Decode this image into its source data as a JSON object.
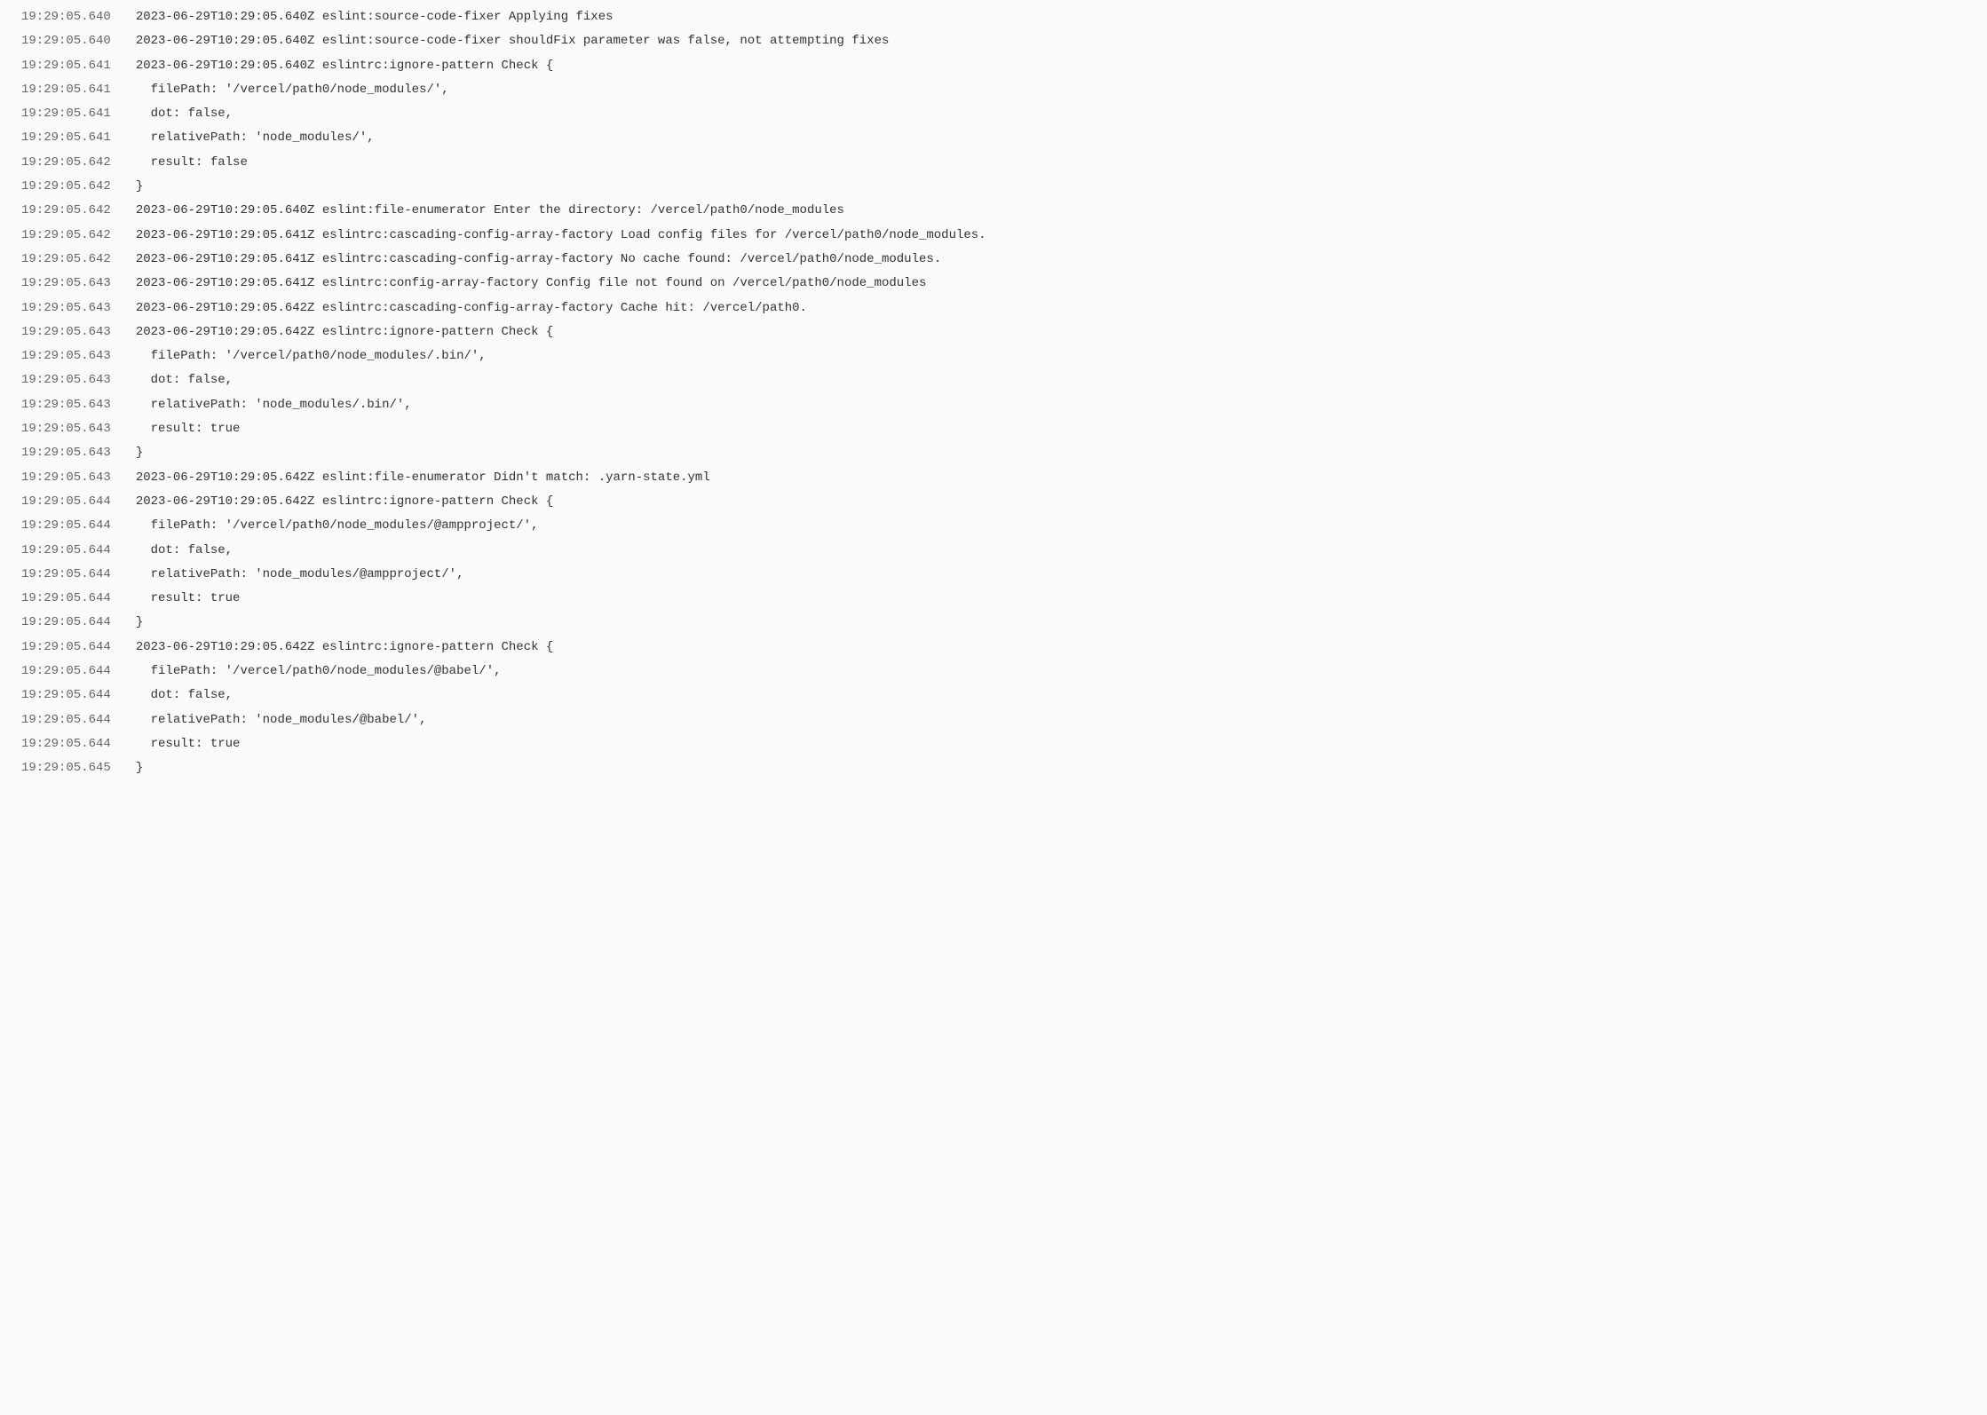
{
  "logs": [
    {
      "ts": "19:29:05.640",
      "msg": "2023-06-29T10:29:05.640Z eslint:source-code-fixer Applying fixes"
    },
    {
      "ts": "19:29:05.640",
      "msg": "2023-06-29T10:29:05.640Z eslint:source-code-fixer shouldFix parameter was false, not attempting fixes"
    },
    {
      "ts": "19:29:05.641",
      "msg": "2023-06-29T10:29:05.640Z eslintrc:ignore-pattern Check {"
    },
    {
      "ts": "19:29:05.641",
      "msg": "  filePath: '/vercel/path0/node_modules/',"
    },
    {
      "ts": "19:29:05.641",
      "msg": "  dot: false,"
    },
    {
      "ts": "19:29:05.641",
      "msg": "  relativePath: 'node_modules/',"
    },
    {
      "ts": "19:29:05.642",
      "msg": "  result: false"
    },
    {
      "ts": "19:29:05.642",
      "msg": "}"
    },
    {
      "ts": "19:29:05.642",
      "msg": "2023-06-29T10:29:05.640Z eslint:file-enumerator Enter the directory: /vercel/path0/node_modules"
    },
    {
      "ts": "19:29:05.642",
      "msg": "2023-06-29T10:29:05.641Z eslintrc:cascading-config-array-factory Load config files for /vercel/path0/node_modules."
    },
    {
      "ts": "19:29:05.642",
      "msg": "2023-06-29T10:29:05.641Z eslintrc:cascading-config-array-factory No cache found: /vercel/path0/node_modules."
    },
    {
      "ts": "19:29:05.643",
      "msg": "2023-06-29T10:29:05.641Z eslintrc:config-array-factory Config file not found on /vercel/path0/node_modules"
    },
    {
      "ts": "19:29:05.643",
      "msg": "2023-06-29T10:29:05.642Z eslintrc:cascading-config-array-factory Cache hit: /vercel/path0."
    },
    {
      "ts": "19:29:05.643",
      "msg": "2023-06-29T10:29:05.642Z eslintrc:ignore-pattern Check {"
    },
    {
      "ts": "19:29:05.643",
      "msg": "  filePath: '/vercel/path0/node_modules/.bin/',"
    },
    {
      "ts": "19:29:05.643",
      "msg": "  dot: false,"
    },
    {
      "ts": "19:29:05.643",
      "msg": "  relativePath: 'node_modules/.bin/',"
    },
    {
      "ts": "19:29:05.643",
      "msg": "  result: true"
    },
    {
      "ts": "19:29:05.643",
      "msg": "}"
    },
    {
      "ts": "19:29:05.643",
      "msg": "2023-06-29T10:29:05.642Z eslint:file-enumerator Didn't match: .yarn-state.yml"
    },
    {
      "ts": "19:29:05.644",
      "msg": "2023-06-29T10:29:05.642Z eslintrc:ignore-pattern Check {"
    },
    {
      "ts": "19:29:05.644",
      "msg": "  filePath: '/vercel/path0/node_modules/@ampproject/',"
    },
    {
      "ts": "19:29:05.644",
      "msg": "  dot: false,"
    },
    {
      "ts": "19:29:05.644",
      "msg": "  relativePath: 'node_modules/@ampproject/',"
    },
    {
      "ts": "19:29:05.644",
      "msg": "  result: true"
    },
    {
      "ts": "19:29:05.644",
      "msg": "}"
    },
    {
      "ts": "19:29:05.644",
      "msg": "2023-06-29T10:29:05.642Z eslintrc:ignore-pattern Check {"
    },
    {
      "ts": "19:29:05.644",
      "msg": "  filePath: '/vercel/path0/node_modules/@babel/',"
    },
    {
      "ts": "19:29:05.644",
      "msg": "  dot: false,"
    },
    {
      "ts": "19:29:05.644",
      "msg": "  relativePath: 'node_modules/@babel/',"
    },
    {
      "ts": "19:29:05.644",
      "msg": "  result: true"
    },
    {
      "ts": "19:29:05.645",
      "msg": "}"
    }
  ]
}
